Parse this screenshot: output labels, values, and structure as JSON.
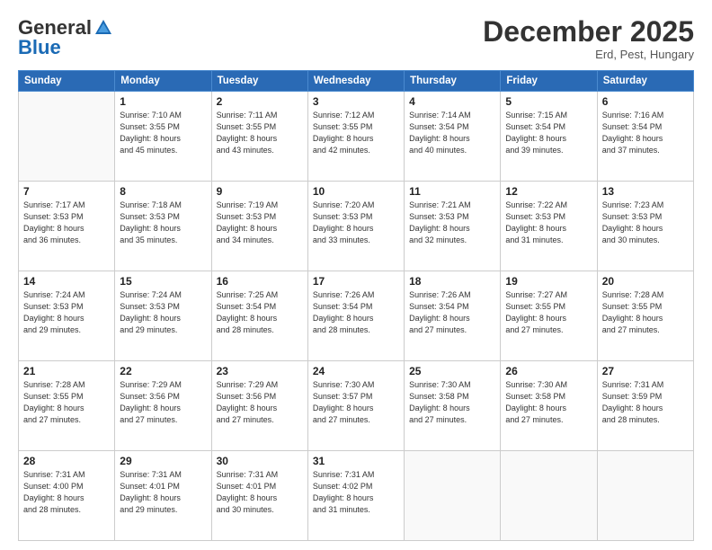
{
  "logo": {
    "general": "General",
    "blue": "Blue"
  },
  "header": {
    "month": "December 2025",
    "location": "Erd, Pest, Hungary"
  },
  "weekdays": [
    "Sunday",
    "Monday",
    "Tuesday",
    "Wednesday",
    "Thursday",
    "Friday",
    "Saturday"
  ],
  "weeks": [
    [
      {
        "day": "",
        "info": ""
      },
      {
        "day": "1",
        "info": "Sunrise: 7:10 AM\nSunset: 3:55 PM\nDaylight: 8 hours\nand 45 minutes."
      },
      {
        "day": "2",
        "info": "Sunrise: 7:11 AM\nSunset: 3:55 PM\nDaylight: 8 hours\nand 43 minutes."
      },
      {
        "day": "3",
        "info": "Sunrise: 7:12 AM\nSunset: 3:55 PM\nDaylight: 8 hours\nand 42 minutes."
      },
      {
        "day": "4",
        "info": "Sunrise: 7:14 AM\nSunset: 3:54 PM\nDaylight: 8 hours\nand 40 minutes."
      },
      {
        "day": "5",
        "info": "Sunrise: 7:15 AM\nSunset: 3:54 PM\nDaylight: 8 hours\nand 39 minutes."
      },
      {
        "day": "6",
        "info": "Sunrise: 7:16 AM\nSunset: 3:54 PM\nDaylight: 8 hours\nand 37 minutes."
      }
    ],
    [
      {
        "day": "7",
        "info": "Sunrise: 7:17 AM\nSunset: 3:53 PM\nDaylight: 8 hours\nand 36 minutes."
      },
      {
        "day": "8",
        "info": "Sunrise: 7:18 AM\nSunset: 3:53 PM\nDaylight: 8 hours\nand 35 minutes."
      },
      {
        "day": "9",
        "info": "Sunrise: 7:19 AM\nSunset: 3:53 PM\nDaylight: 8 hours\nand 34 minutes."
      },
      {
        "day": "10",
        "info": "Sunrise: 7:20 AM\nSunset: 3:53 PM\nDaylight: 8 hours\nand 33 minutes."
      },
      {
        "day": "11",
        "info": "Sunrise: 7:21 AM\nSunset: 3:53 PM\nDaylight: 8 hours\nand 32 minutes."
      },
      {
        "day": "12",
        "info": "Sunrise: 7:22 AM\nSunset: 3:53 PM\nDaylight: 8 hours\nand 31 minutes."
      },
      {
        "day": "13",
        "info": "Sunrise: 7:23 AM\nSunset: 3:53 PM\nDaylight: 8 hours\nand 30 minutes."
      }
    ],
    [
      {
        "day": "14",
        "info": "Sunrise: 7:24 AM\nSunset: 3:53 PM\nDaylight: 8 hours\nand 29 minutes."
      },
      {
        "day": "15",
        "info": "Sunrise: 7:24 AM\nSunset: 3:53 PM\nDaylight: 8 hours\nand 29 minutes."
      },
      {
        "day": "16",
        "info": "Sunrise: 7:25 AM\nSunset: 3:54 PM\nDaylight: 8 hours\nand 28 minutes."
      },
      {
        "day": "17",
        "info": "Sunrise: 7:26 AM\nSunset: 3:54 PM\nDaylight: 8 hours\nand 28 minutes."
      },
      {
        "day": "18",
        "info": "Sunrise: 7:26 AM\nSunset: 3:54 PM\nDaylight: 8 hours\nand 27 minutes."
      },
      {
        "day": "19",
        "info": "Sunrise: 7:27 AM\nSunset: 3:55 PM\nDaylight: 8 hours\nand 27 minutes."
      },
      {
        "day": "20",
        "info": "Sunrise: 7:28 AM\nSunset: 3:55 PM\nDaylight: 8 hours\nand 27 minutes."
      }
    ],
    [
      {
        "day": "21",
        "info": "Sunrise: 7:28 AM\nSunset: 3:55 PM\nDaylight: 8 hours\nand 27 minutes."
      },
      {
        "day": "22",
        "info": "Sunrise: 7:29 AM\nSunset: 3:56 PM\nDaylight: 8 hours\nand 27 minutes."
      },
      {
        "day": "23",
        "info": "Sunrise: 7:29 AM\nSunset: 3:56 PM\nDaylight: 8 hours\nand 27 minutes."
      },
      {
        "day": "24",
        "info": "Sunrise: 7:30 AM\nSunset: 3:57 PM\nDaylight: 8 hours\nand 27 minutes."
      },
      {
        "day": "25",
        "info": "Sunrise: 7:30 AM\nSunset: 3:58 PM\nDaylight: 8 hours\nand 27 minutes."
      },
      {
        "day": "26",
        "info": "Sunrise: 7:30 AM\nSunset: 3:58 PM\nDaylight: 8 hours\nand 27 minutes."
      },
      {
        "day": "27",
        "info": "Sunrise: 7:31 AM\nSunset: 3:59 PM\nDaylight: 8 hours\nand 28 minutes."
      }
    ],
    [
      {
        "day": "28",
        "info": "Sunrise: 7:31 AM\nSunset: 4:00 PM\nDaylight: 8 hours\nand 28 minutes."
      },
      {
        "day": "29",
        "info": "Sunrise: 7:31 AM\nSunset: 4:01 PM\nDaylight: 8 hours\nand 29 minutes."
      },
      {
        "day": "30",
        "info": "Sunrise: 7:31 AM\nSunset: 4:01 PM\nDaylight: 8 hours\nand 30 minutes."
      },
      {
        "day": "31",
        "info": "Sunrise: 7:31 AM\nSunset: 4:02 PM\nDaylight: 8 hours\nand 31 minutes."
      },
      {
        "day": "",
        "info": ""
      },
      {
        "day": "",
        "info": ""
      },
      {
        "day": "",
        "info": ""
      }
    ]
  ]
}
